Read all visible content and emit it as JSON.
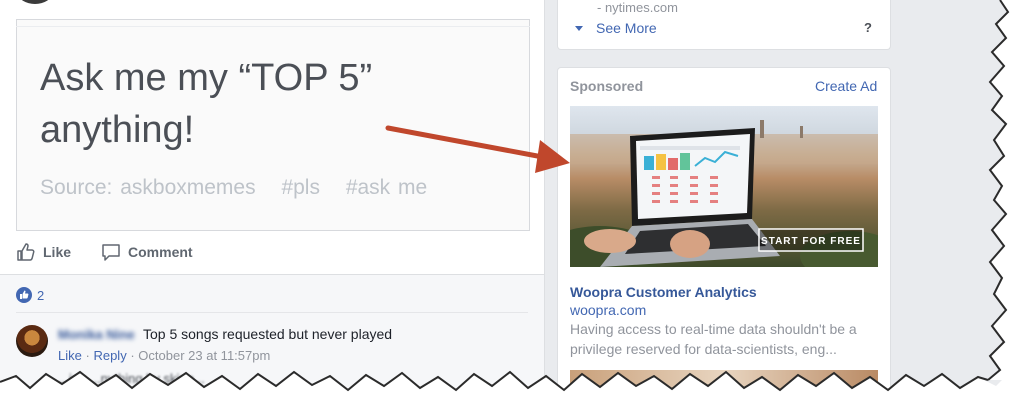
{
  "post": {
    "meme": {
      "title": "Ask me my “TOP 5” anything!",
      "source": "Source: askboxmemes",
      "tags": [
        "#pls",
        "#ask me"
      ]
    },
    "actions": {
      "like": "Like",
      "comment": "Comment"
    },
    "reactions_count": "2",
    "comment": {
      "author": "Monika Nine",
      "text": "Top 5 songs requested but never played",
      "like": "Like",
      "reply": "Reply",
      "sep": "·",
      "timestamp": "October 23 at 11:57pm"
    },
    "next_comment_preview": "...ing ...nything by skipp..."
  },
  "sidebar": {
    "source_domain": "- nytimes.com",
    "see_more": "See More",
    "help": "?"
  },
  "ad": {
    "sponsored": "Sponsored",
    "create_ad": "Create Ad",
    "cta": "START FOR FREE",
    "title": "Woopra Customer Analytics",
    "domain": "woopra.com",
    "description": "Having access to real-time data shouldn't be a privilege reserved for data-scientists, eng..."
  },
  "colors": {
    "link": "#4267b2",
    "arrow": "#c0472c",
    "background": "#e9ebee"
  }
}
